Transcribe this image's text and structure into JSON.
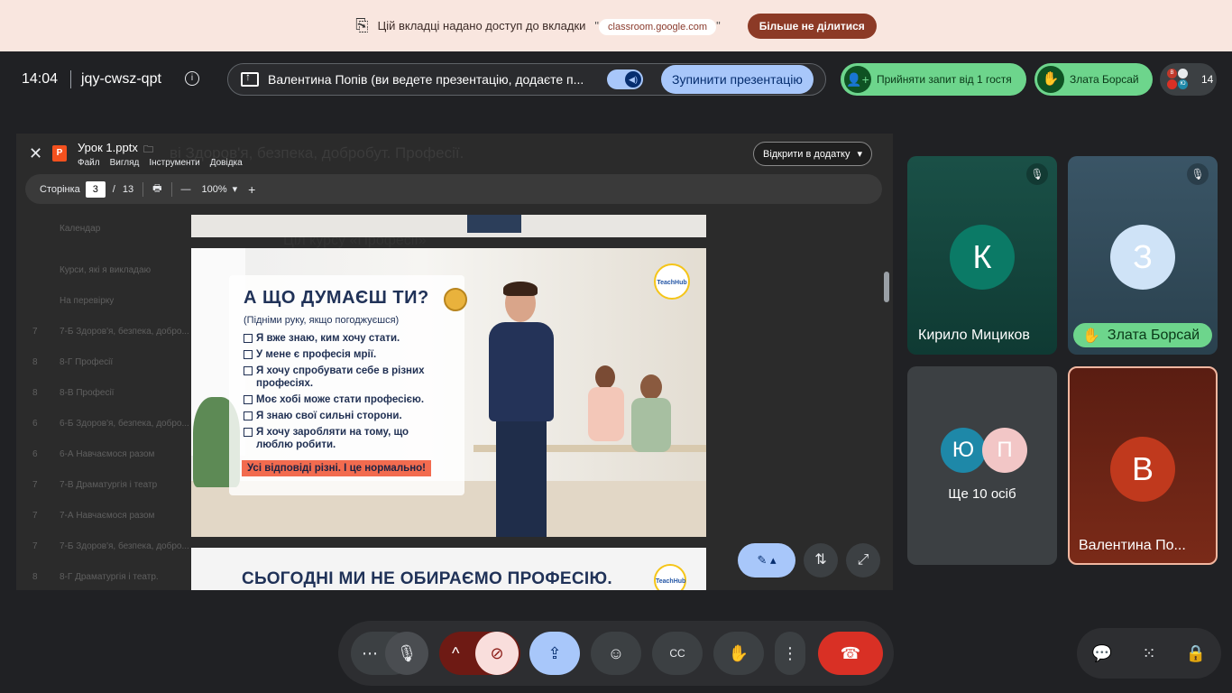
{
  "banner": {
    "message": "Цій вкладці надано доступ до вкладки",
    "quote_open": "\"",
    "quote_close": "\"",
    "shared_tab": "classroom.google.com",
    "stop_label": "Більше не ділитися"
  },
  "meeting": {
    "time": "14:04",
    "code": "jqy-cwsz-qpt",
    "presenting_text": "Валентина Попів (ви ведете презентацію, додаєте п...",
    "stop_presenting_label": "Зупинити презентацію",
    "accept_guest_label": "Прийняти запит від 1 гостя",
    "raised_hand_name": "Злата Борсай",
    "participant_count": "14",
    "mini_avatars": [
      "В",
      "Ю"
    ]
  },
  "viewer": {
    "file_name": "Урок 1.pptx",
    "menus": [
      "Файл",
      "Вигляд",
      "Інструменти",
      "Довідка"
    ],
    "open_in_app_label": "Відкрити в додатку",
    "page_label": "Сторінка",
    "current_page": "3",
    "page_separator": "/",
    "total_pages": "13",
    "zoom": "100%",
    "background_title": "ві Здоров'я, безпека, добробут. Професії.",
    "background_rows": [
      {
        "num": "",
        "text": "Календар"
      },
      {
        "num": "",
        "text": "Курси, які я викладаю"
      },
      {
        "num": "",
        "text": "На перевірку"
      },
      {
        "num": "7",
        "text": "7-Б Здоров'я, безпека, добро..."
      },
      {
        "num": "8",
        "text": "8-Г Професії"
      },
      {
        "num": "8",
        "text": "8-В Професії"
      },
      {
        "num": "6",
        "text": "6-Б Здоров'я, безпека, добро..."
      },
      {
        "num": "6",
        "text": "6-А Навчаємося разом"
      },
      {
        "num": "7",
        "text": "7-В Драматургія і театр"
      },
      {
        "num": "7",
        "text": "7-А Навчаємося разом"
      },
      {
        "num": "7",
        "text": "7-Б Здоров'я, безпека, добро..."
      },
      {
        "num": "8",
        "text": "8-Г Драматургія і театр."
      }
    ],
    "background_heading": "Ціл курсу «Професії»"
  },
  "slide": {
    "title": "А ЩО ДУМАЄШ ТИ?",
    "subtitle": "(Підніми руку, якщо погоджуєшся)",
    "items": [
      "Я вже знаю, ким хочу стати.",
      "У мене є професія мрії.",
      "Я хочу спробувати себе в різних професіях.",
      "Моє хобі може стати професією.",
      "Я знаю свої сильні сторони.",
      "Я хочу заробляти на тому, що люблю робити."
    ],
    "footer": "Усі відповіді різні. І це нормально!",
    "logo_text": "TeachHub",
    "next_slide_heading": "СЬОГОДНІ МИ НЕ ОБИРАЄМО ПРОФЕСІЮ."
  },
  "tiles": {
    "kyrylo": {
      "initial": "К",
      "name": "Кирило Мициков",
      "color": "#0b7a66"
    },
    "zlata": {
      "initial": "З",
      "name": "Злата Борсай",
      "color": "#cfe3f7"
    },
    "others": {
      "initials": [
        "Ю",
        "П"
      ],
      "label": "Ще 10 осіб"
    },
    "valentyna": {
      "initial": "В",
      "name": "Валентина По..."
    }
  },
  "colors": {
    "accent": "#a8c7fa",
    "green": "#6dd58c",
    "end_call": "#d93025",
    "banner_bg": "#f9e6df",
    "banner_btn": "#8c3a26"
  }
}
